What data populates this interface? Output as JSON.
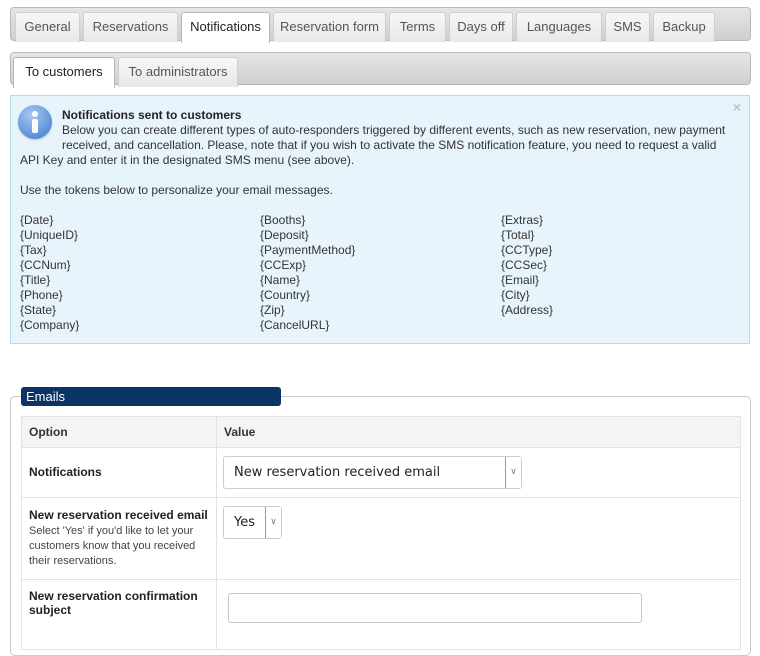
{
  "main_tabs": [
    {
      "label": "General",
      "active": false
    },
    {
      "label": "Reservations",
      "active": false
    },
    {
      "label": "Notifications",
      "active": true
    },
    {
      "label": "Reservation form",
      "active": false
    },
    {
      "label": "Terms",
      "active": false
    },
    {
      "label": "Days off",
      "active": false
    },
    {
      "label": "Languages",
      "active": false
    },
    {
      "label": "SMS",
      "active": false
    },
    {
      "label": "Backup",
      "active": false
    }
  ],
  "sub_tabs": [
    {
      "label": "To customers",
      "active": true
    },
    {
      "label": "To administrators",
      "active": false
    }
  ],
  "info": {
    "icon": "info-icon",
    "close_icon": "×",
    "title": "Notifications sent to customers",
    "line1": "Below you can create different types of auto-responders triggered by different events, such as new reservation, new payment",
    "line2": "received, and cancellation. Please, note that if you wish to activate the SMS notification feature, you need to request a valid",
    "line3": "API Key and enter it in the designated SMS menu (see above).",
    "tokens_intro": "Use the tokens below to personalize your email messages.",
    "tokens": [
      [
        "{Date}",
        "{UniqueID}",
        "{Tax}",
        "{CCNum}",
        "{Title}",
        "{Phone}",
        "{State}",
        "{Company}"
      ],
      [
        "{Booths}",
        "{Deposit}",
        "{PaymentMethod}",
        "{CCExp}",
        "{Name}",
        "{Country}",
        "{Zip}",
        "{CancelURL}"
      ],
      [
        "{Extras}",
        "{Total}",
        "{CCType}",
        "{CCSec}",
        "{Email}",
        "{City}",
        "{Address}"
      ]
    ]
  },
  "emails": {
    "legend": "Emails",
    "header_option": "Option",
    "header_value": "Value",
    "rows": [
      {
        "label": "Notifications",
        "type": "select",
        "value": "New reservation received email"
      },
      {
        "label": "New reservation received email",
        "description": "Select 'Yes' if you'd like to let your customers know that you received their reservations.",
        "type": "select",
        "value": "Yes"
      },
      {
        "label": "New reservation confirmation subject",
        "type": "text",
        "value": ""
      }
    ]
  }
}
